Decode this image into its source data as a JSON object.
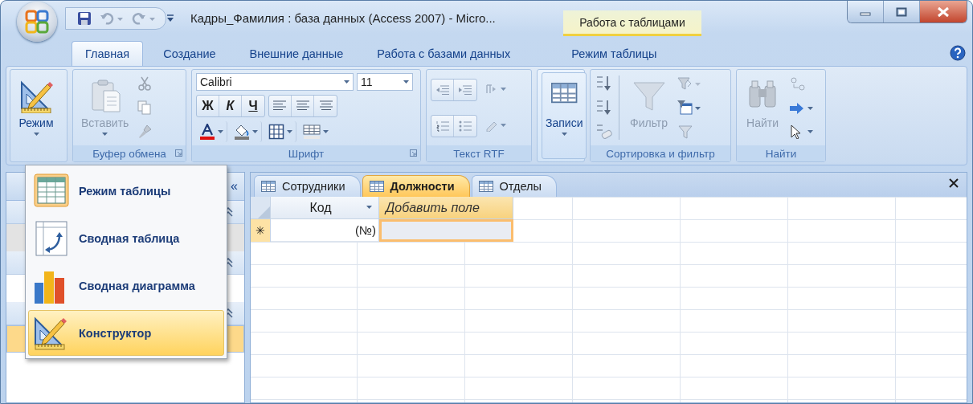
{
  "title_bar": {
    "title": "Кадры_Фамилия : база данных (Access 2007) - Micro...",
    "context_tab": "Работа с таблицами"
  },
  "ribbon_tabs": [
    {
      "label": "Главная",
      "selected": true
    },
    {
      "label": "Создание",
      "selected": false
    },
    {
      "label": "Внешние данные",
      "selected": false
    },
    {
      "label": "Работа с базами данных",
      "selected": false
    },
    {
      "label": "Режим таблицы",
      "selected": false
    }
  ],
  "ribbon": {
    "mode": {
      "label": "Режим",
      "disabled": false
    },
    "clipboard": {
      "paste": {
        "label": "Вставить",
        "disabled": true
      },
      "group_label": "Буфер обмена"
    },
    "font": {
      "font_name": "Calibri",
      "font_size": "11",
      "bold": "Ж",
      "italic": "К",
      "underline": "Ч",
      "group_label": "Шрифт"
    },
    "rtf": {
      "group_label": "Текст RTF"
    },
    "records": {
      "label": "Записи",
      "disabled": false
    },
    "sort_filter": {
      "filter": {
        "label": "Фильтр",
        "disabled": true
      },
      "group_label": "Сортировка и фильтр"
    },
    "find": {
      "find": {
        "label": "Найти",
        "disabled": true
      },
      "group_label": "Найти"
    }
  },
  "nav_pane": {
    "collapse": "«"
  },
  "doc_tabs": [
    {
      "label": "Сотрудники",
      "selected": false
    },
    {
      "label": "Должности",
      "selected": true
    },
    {
      "label": "Отделы",
      "selected": false
    }
  ],
  "datasheet": {
    "columns": [
      {
        "label": "Код",
        "kind": "field"
      },
      {
        "label": "Добавить поле",
        "kind": "add"
      }
    ],
    "new_row": {
      "marker": "✳",
      "id": "(№)"
    }
  },
  "view_menu": {
    "items": [
      {
        "label": "Режим таблицы",
        "kind": "datasheet",
        "selected": false
      },
      {
        "label": "Сводная таблица",
        "kind": "pivot_table",
        "selected": false
      },
      {
        "label": "Сводная диаграмма",
        "kind": "pivot_chart",
        "selected": false
      },
      {
        "label": "Конструктор",
        "kind": "design",
        "selected": true
      }
    ]
  }
}
